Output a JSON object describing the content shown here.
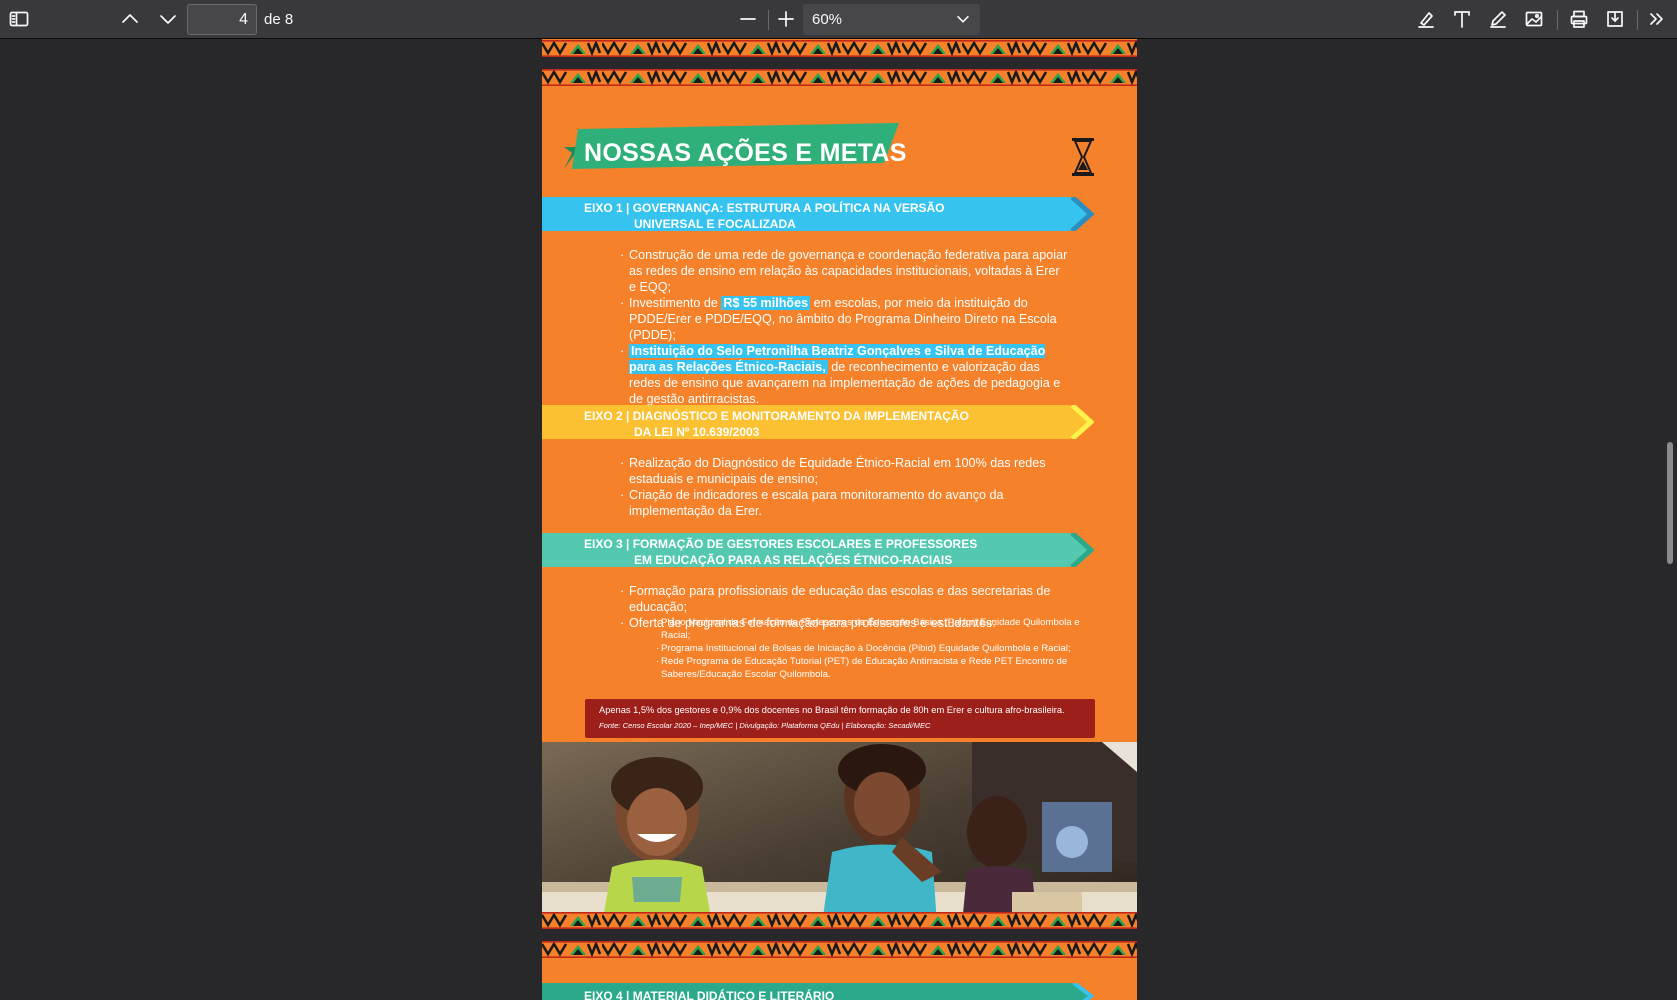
{
  "toolbar": {
    "sidebar_icon": "sidebar-toggle-icon",
    "prev_icon": "chevron-up-icon",
    "next_icon": "chevron-down-icon",
    "page_number": "4",
    "page_total_label": "de 8",
    "zoom_out_icon": "minus-icon",
    "zoom_in_icon": "plus-icon",
    "zoom_value": "60%",
    "tools": [
      "highlight-icon",
      "text-icon",
      "draw-icon",
      "image-icon",
      "print-icon",
      "save-icon",
      "more-tools-icon"
    ]
  },
  "document": {
    "title": "NOSSAS AÇÕES E METAS",
    "eixos": [
      {
        "line1": "EIXO 1 | GOVERNANÇA: ESTRUTURA A POLÍTICA NA VERSÃO",
        "line2": "UNIVERSAL E FOCALIZADA",
        "color": "#36c3ef"
      },
      {
        "line1": "EIXO 2 | DIAGNÓSTICO E MONITORAMENTO DA IMPLEMENTAÇÃO",
        "line2": "DA LEI Nº 10.639/2003",
        "color": "#fcc133"
      },
      {
        "line1": "EIXO 3 | FORMAÇÃO DE GESTORES ESCOLARES E PROFESSORES",
        "line2": "EM EDUCAÇÃO PARA AS RELAÇÕES ÉTNICO-RACIAIS",
        "color": "#54c9b0"
      },
      {
        "line1": "EIXO 4 | MATERIAL DIDÁTICO E LITERÁRIO",
        "line2": "",
        "color": "#2aaa8a"
      }
    ],
    "eixo1_bullets": {
      "b1": "Construção de uma rede de governança e coordenação federativa para apoiar as redes de ensino em relação às capacidades institucionais, voltadas à Erer e EQQ;",
      "b2_pre": "Investimento de ",
      "b2_hl": "R$ 55 milhões",
      "b2_post": " em escolas, por meio da instituição do PDDE/Erer e PDDE/EQQ, no âmbito do Programa Dinheiro Direto na Escola (PDDE);",
      "b3_hl": "Instituição do Selo Petronilha Beatriz Gonçalves e Silva de Educação para as Relações Étnico-Raciais,",
      "b3_post": " de reconhecimento e valorização das redes de ensino que avançarem na implementação de ações de pedagogia e de gestão antirracistas."
    },
    "eixo2_bullets": [
      "Realização do Diagnóstico de Equidade Étnico-Racial em 100% das redes estaduais e municipais de ensino;",
      "Criação de indicadores e escala para monitoramento do avanço da implementação da Erer."
    ],
    "eixo3_bullets": [
      "Formação para profissionais de educação das escolas e das secretarias de educação;",
      "Oferta de programas de formação para professores e estudantes:"
    ],
    "eixo3_sub": [
      "Plano Nacional de Formação de Professores da Educação Básica (Parfor) Equidade Quilombola e Racial;",
      "Programa Institucional de Bolsas de Iniciação à Docência (Pibid) Equidade Quilombola e Racial;",
      "Rede Programa de Educação Tutorial (PET) de Educação Antirracista e Rede PET Encontro de Saberes/Educação Escolar Quilombola."
    ],
    "callout": {
      "text": "Apenas 1,5% dos gestores e 0,9% dos docentes no Brasil têm formação de 80h em Erer e cultura afro-brasileira.",
      "source": "Fonte: Censo Escolar 2020 – Inep/MEC | Divulgação: Plataforma QEdu | Elaboração: Secadi/MEC"
    },
    "photo_icon": "students-photo"
  }
}
